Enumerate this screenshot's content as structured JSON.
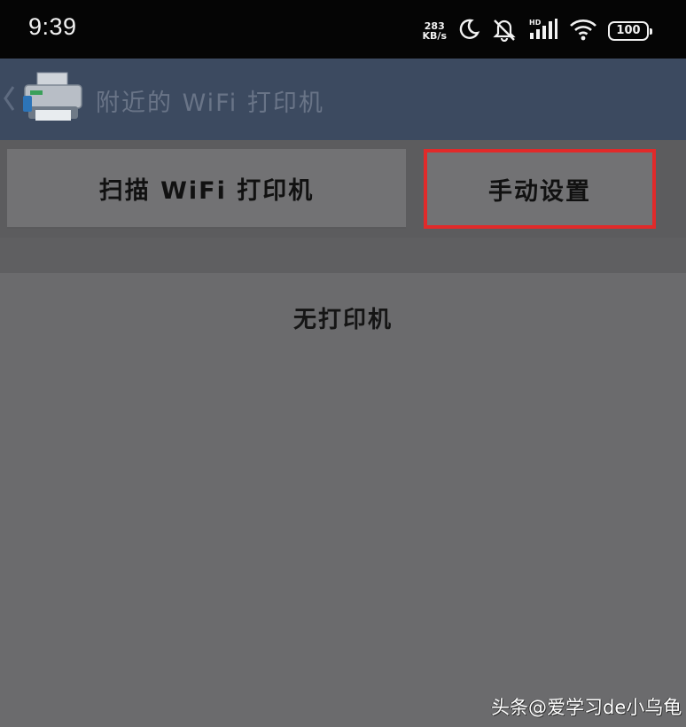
{
  "status_bar": {
    "time": "9:39",
    "net_speed_value": "283",
    "net_speed_unit": "KB/s",
    "battery": "100",
    "icons": [
      "moon-icon",
      "mute-icon",
      "hd-signal-icon",
      "wifi-icon",
      "battery-icon"
    ]
  },
  "app_bar": {
    "title": "附近的 WiFi 打印机",
    "back_icon": "chevron-left-icon",
    "app_icon": "printer-icon",
    "color": "#3c4a60"
  },
  "actions": {
    "scan_label": "扫描 WiFi 打印机",
    "manual_label": "手动设置",
    "highlight_color": "#e12a2a"
  },
  "list": {
    "empty_text": "无打印机"
  },
  "watermark": {
    "text": "头条@爱学习de小乌龟"
  }
}
